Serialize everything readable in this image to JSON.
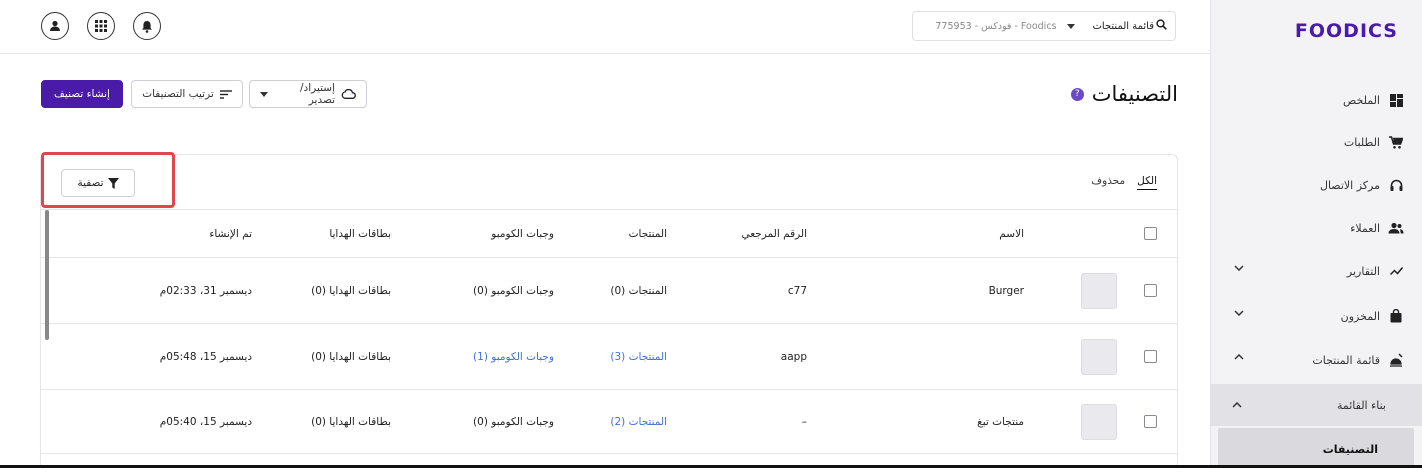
{
  "brand": {
    "logo_text": "FOODICS",
    "accent": "#4a1aa8",
    "highlight": "#e0474c",
    "link": "#3e72d6"
  },
  "topbar": {
    "menu_select": "قائمة المنتجات",
    "branch": "Foodics - فودكس - 775953",
    "icons": [
      "user-icon",
      "apps-grid-icon",
      "bell-icon"
    ]
  },
  "sidebar": {
    "items": [
      {
        "label": "الملخص",
        "icon": "dashboard-icon"
      },
      {
        "label": "الطلبات",
        "icon": "cart-icon"
      },
      {
        "label": "مركز الاتصال",
        "icon": "headset-icon"
      },
      {
        "label": "العملاء",
        "icon": "users-icon"
      },
      {
        "label": "التقارير",
        "icon": "chart-line-icon"
      },
      {
        "label": "المخزون",
        "icon": "bag-icon"
      },
      {
        "label": "قائمة المنتجات",
        "icon": "menu-icon"
      }
    ],
    "sub_items": [
      {
        "label": "بناء القائمة"
      },
      {
        "label": "التصنيفات"
      }
    ]
  },
  "header": {
    "title": "التصنيفات",
    "create_button": "إنشاء تصنيف",
    "sort_button": "ترتيب التصنيفات",
    "import_export_button": "إستيراد/ تصدير"
  },
  "tabs": {
    "all": "الكل",
    "deleted": "محذوف"
  },
  "filter_button": "تصفية",
  "table": {
    "columns": [
      "الاسم",
      "الرقم المرجعي",
      "المنتجات",
      "وجبات الكومبو",
      "بطاقات الهدايا",
      "تم الإنشاء"
    ],
    "rows": [
      {
        "name": "Burger",
        "ref": "c77",
        "products": "المنتجات (0)",
        "combos": "وجبات الكومبو (0)",
        "gift_cards": "بطاقات الهدايا (0)",
        "created": "ديسمبر 31، 02:33م"
      },
      {
        "name": "",
        "ref": "aapp",
        "products": "المنتجات (3)",
        "combos": "وجبات الكومبو (1)",
        "gift_cards": "بطاقات الهدايا (0)",
        "created": "ديسمبر 15، 05:48م"
      },
      {
        "name": "منتجات تبغ",
        "ref": "–",
        "products": "المنتجات (2)",
        "combos": "وجبات الكومبو (0)",
        "gift_cards": "بطاقات الهدايا (0)",
        "created": "ديسمبر 15، 05:40م"
      }
    ]
  }
}
